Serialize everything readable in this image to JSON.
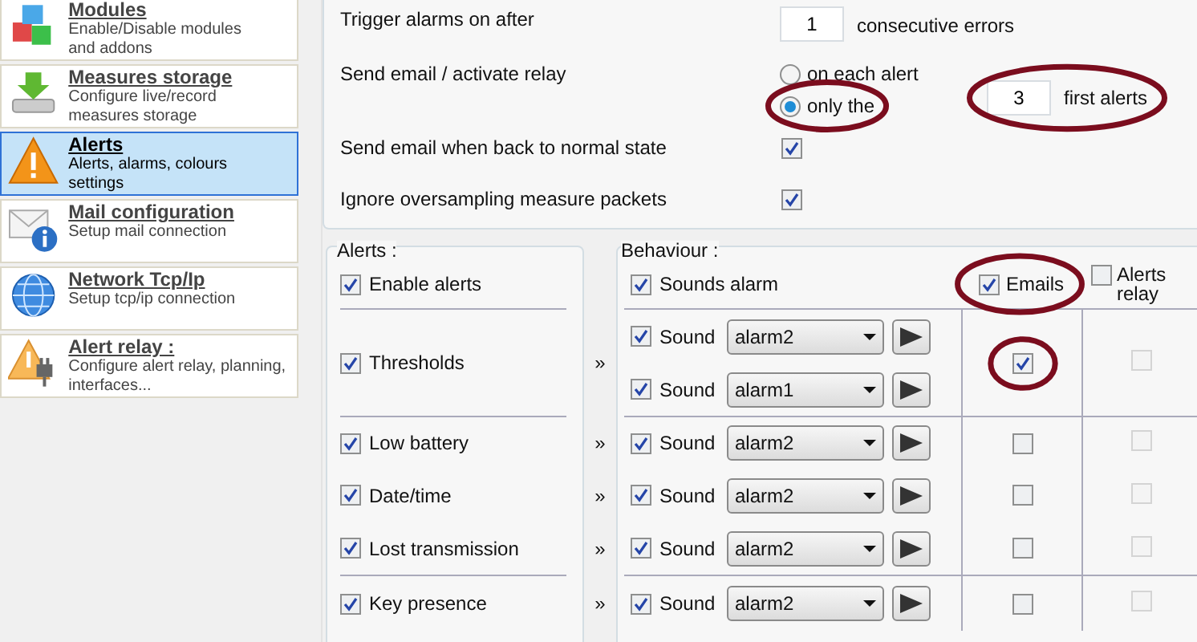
{
  "sidebar": {
    "items": [
      {
        "title": "Modules",
        "description": "Enable/Disable modules and addons",
        "selected": false
      },
      {
        "title": "Measures storage",
        "description": "Configure live/record measures storage",
        "selected": false
      },
      {
        "title": "Alerts",
        "description": "Alerts, alarms, colours settings",
        "selected": true
      },
      {
        "title": "Mail configuration",
        "description": "Setup mail connection",
        "selected": false
      },
      {
        "title": "Network Tcp/Ip",
        "description": "Setup tcp/ip connection",
        "selected": false
      },
      {
        "title": "Alert relay :",
        "description": "Configure alert relay, planning, interfaces...",
        "selected": false
      }
    ]
  },
  "settings": {
    "trigger": {
      "label": "Trigger alarms on after",
      "value": "1",
      "suffix": "consecutive errors"
    },
    "send_mode": {
      "label": "Send email / activate relay",
      "options": [
        {
          "label": "on each alert",
          "selected": false,
          "highlighted": false
        },
        {
          "label": "only the",
          "selected": true,
          "highlighted": true
        }
      ],
      "count": {
        "value": "3",
        "suffix": "first alerts",
        "highlighted": true
      }
    },
    "checks": [
      {
        "label": "Send email when back to normal state",
        "checked": true
      },
      {
        "label": "Ignore oversampling measure packets",
        "checked": true
      }
    ]
  },
  "alerts": {
    "title": "Alerts :",
    "enable": {
      "label": "Enable alerts",
      "checked": true
    }
  },
  "behaviour": {
    "title": "Behaviour :",
    "sounds_alarm": {
      "label": "Sounds alarm",
      "checked": true
    },
    "emails": {
      "label": "Emails",
      "checked": true,
      "highlighted": true
    },
    "relay": {
      "label": "Alerts relay",
      "checked": false
    }
  },
  "groups": [
    {
      "alerts": [
        {
          "label": "Thresholds",
          "checked": true,
          "arrow": "»"
        }
      ],
      "sounds": [
        {
          "label": "Sound",
          "checked": true,
          "value": "alarm2"
        },
        {
          "label": "Sound",
          "checked": true,
          "value": "alarm1"
        }
      ],
      "emails": [
        {
          "checked": true,
          "highlighted": true
        }
      ],
      "relays": [
        {
          "checked": false,
          "disabled": true
        }
      ]
    },
    {
      "alerts": [
        {
          "label": "Low battery",
          "checked": true,
          "arrow": "»"
        },
        {
          "label": "Date/time",
          "checked": true,
          "arrow": "»"
        },
        {
          "label": "Lost transmission",
          "checked": true,
          "arrow": "»"
        }
      ],
      "sounds": [
        {
          "label": "Sound",
          "checked": true,
          "value": "alarm2"
        },
        {
          "label": "Sound",
          "checked": true,
          "value": "alarm2"
        },
        {
          "label": "Sound",
          "checked": true,
          "value": "alarm2"
        }
      ],
      "emails": [
        {
          "checked": false,
          "highlighted": false
        },
        {
          "checked": false,
          "highlighted": false
        },
        {
          "checked": false,
          "highlighted": false
        }
      ],
      "relays": [
        {
          "checked": false,
          "disabled": true
        },
        {
          "checked": false,
          "disabled": true
        },
        {
          "checked": false,
          "disabled": true
        }
      ]
    },
    {
      "alerts": [
        {
          "label": "Key presence",
          "checked": true,
          "arrow": "»"
        }
      ],
      "sounds": [
        {
          "label": "Sound",
          "checked": true,
          "value": "alarm2"
        }
      ],
      "emails": [
        {
          "checked": false,
          "highlighted": false
        }
      ],
      "relays": [
        {
          "checked": false,
          "disabled": true
        }
      ]
    }
  ]
}
